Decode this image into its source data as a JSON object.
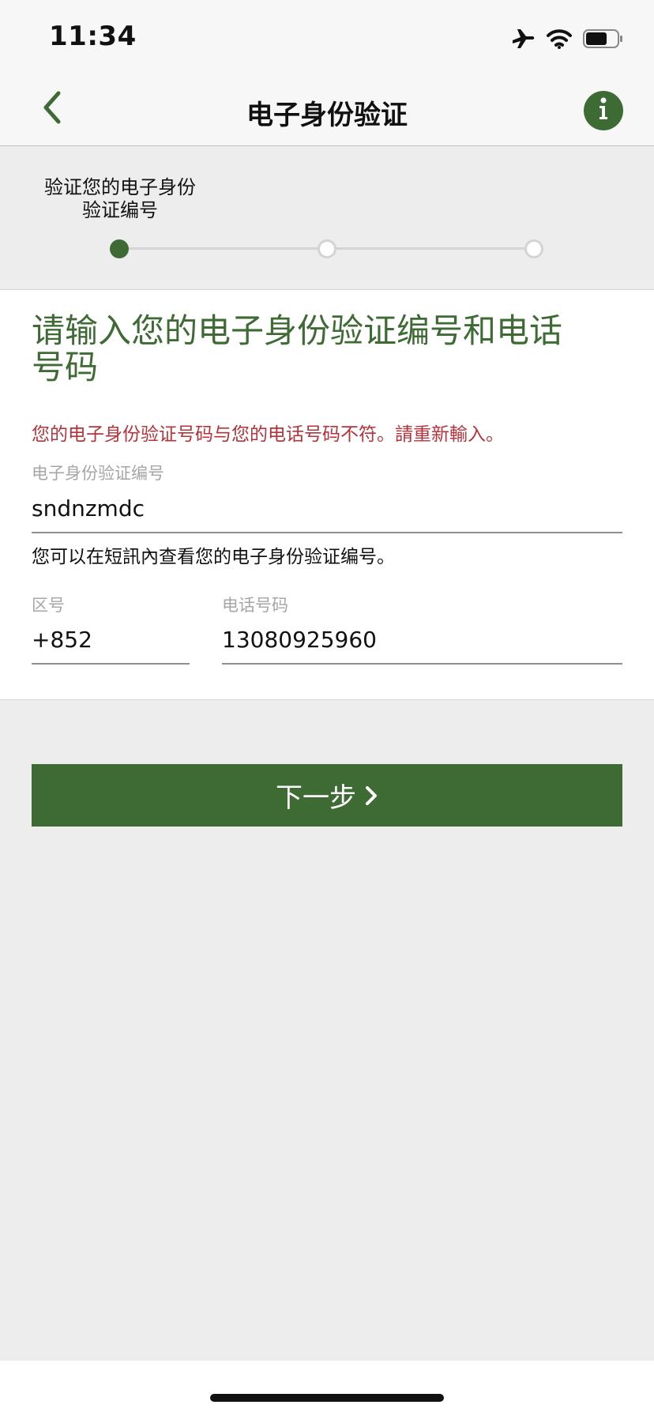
{
  "status_bar": {
    "time": "11:34",
    "icons": [
      "airplane-icon",
      "wifi-icon",
      "battery-icon"
    ]
  },
  "nav": {
    "title": "电子身份验证",
    "back_icon": "chevron-left-icon",
    "info_icon": "info-icon"
  },
  "stepper": {
    "step_label": "验证您的电子身份\n验证编号",
    "steps": 3,
    "active_step": 1
  },
  "form": {
    "heading": "请输入您的电子身份验证编号和电话号码",
    "error": "您的电子身份验证号码与您的电话号码不符。請重新輸入。",
    "eid_label": "电子身份验证编号",
    "eid_value": "sndnzmdc",
    "hint": "您可以在短訊內查看您的电子身份验证编号。",
    "area_code_label": "区号",
    "area_code_value": "+852",
    "phone_label": "电话号码",
    "phone_value": "13080925960"
  },
  "next_button": {
    "label": "下一步",
    "icon": "chevron-right-icon"
  },
  "colors": {
    "brand_green": "#3e6b34",
    "error_red": "#b8323a",
    "background": "#ededed"
  }
}
